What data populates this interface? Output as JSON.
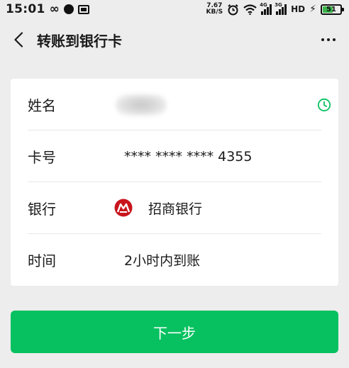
{
  "status_bar": {
    "time": "15:01",
    "link_glyph": "∞",
    "speed_value": "7.67",
    "speed_unit": "KB/S",
    "signal1_tag": "4G",
    "signal2_tag": "3G",
    "hd": "HD",
    "battery": "51",
    "battery_color": "#3bb54a"
  },
  "nav": {
    "title": "转账到银行卡",
    "back_icon": "chevron-left-icon",
    "more_icon": "more-dots-icon"
  },
  "form": {
    "rows": [
      {
        "label": "姓名",
        "value": ""
      },
      {
        "label": "卡号",
        "value": "**** **** **** 4355"
      },
      {
        "label": "银行",
        "value": "招商银行"
      },
      {
        "label": "时间",
        "value": "2小时内到账"
      }
    ]
  },
  "actions": {
    "next_label": "下一步"
  },
  "colors": {
    "accent": "#07c160",
    "bank_brand": "#c8151d"
  }
}
